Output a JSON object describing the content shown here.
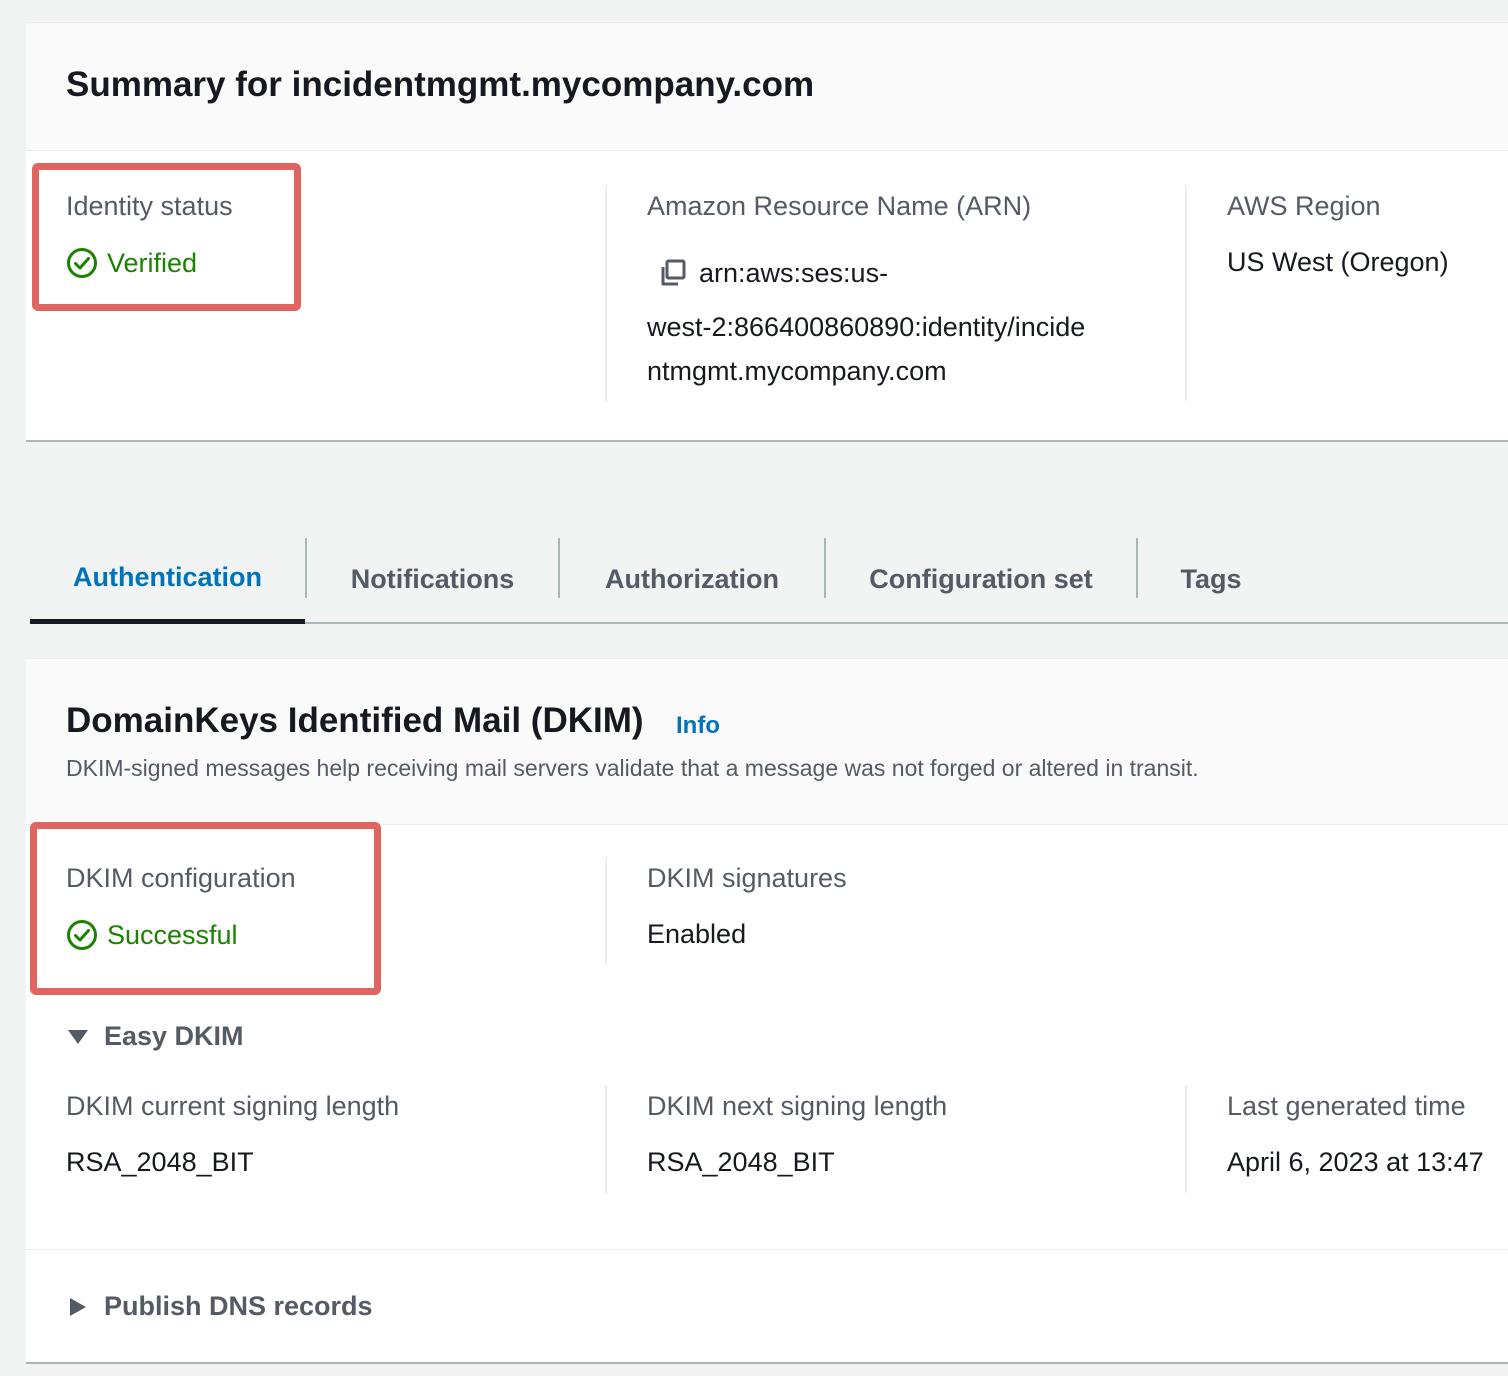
{
  "summary": {
    "title": "Summary for incidentmgmt.mycompany.com",
    "identity_status_label": "Identity status",
    "identity_status_value": "Verified",
    "arn_label": "Amazon Resource Name (ARN)",
    "arn_lines": [
      "arn:aws:ses:us-",
      "west-2:866400860890:identity/incide",
      "ntmgmt.mycompany.com"
    ],
    "region_label": "AWS Region",
    "region_value": "US West (Oregon)"
  },
  "tabs": [
    {
      "label": "Authentication",
      "active": true
    },
    {
      "label": "Notifications",
      "active": false
    },
    {
      "label": "Authorization",
      "active": false
    },
    {
      "label": "Configuration set",
      "active": false
    },
    {
      "label": "Tags",
      "active": false
    }
  ],
  "dkim": {
    "title": "DomainKeys Identified Mail (DKIM)",
    "info_link": "Info",
    "description": "DKIM-signed messages help receiving mail servers validate that a message was not forged or altered in transit.",
    "configuration_label": "DKIM configuration",
    "configuration_value": "Successful",
    "signatures_label": "DKIM signatures",
    "signatures_value": "Enabled",
    "easy_dkim": {
      "label": "Easy DKIM",
      "expanded": true,
      "current_length_label": "DKIM current signing length",
      "current_length_value": "RSA_2048_BIT",
      "next_length_label": "DKIM next signing length",
      "next_length_value": "RSA_2048_BIT",
      "last_generated_label": "Last generated time",
      "last_generated_value": "April 6, 2023 at 13:47"
    },
    "publish_dns": {
      "label": "Publish DNS records",
      "expanded": false
    }
  },
  "colors": {
    "success": "#1d8102",
    "link": "#0073bb",
    "highlight": "#e0645f",
    "background": "#f2f3f3"
  }
}
